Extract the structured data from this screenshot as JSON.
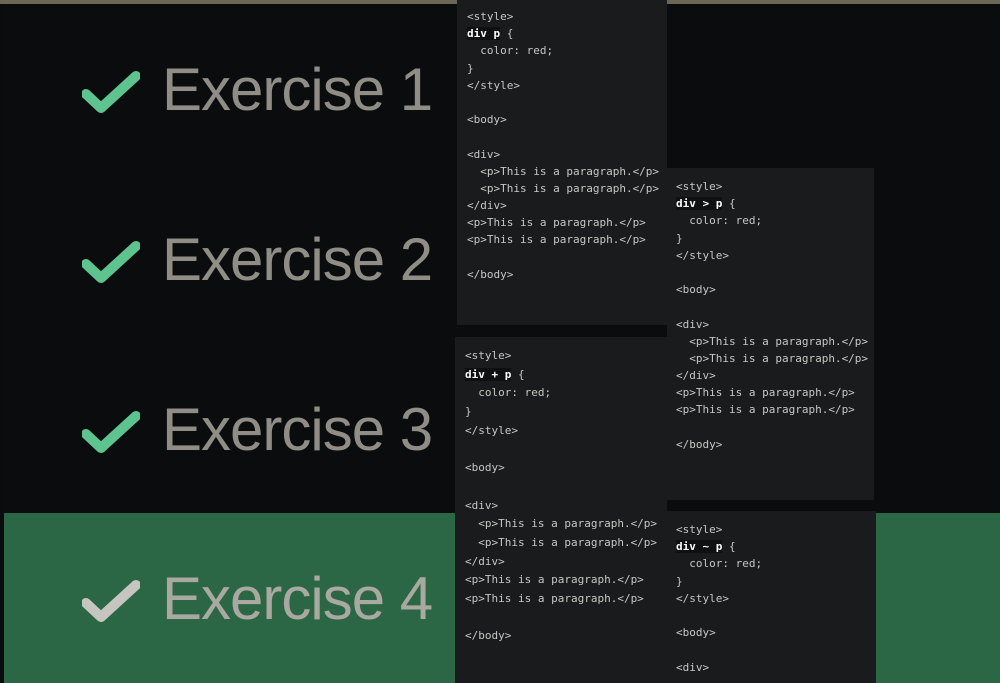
{
  "exercises": [
    {
      "label": "Exercise 1",
      "status": "completed",
      "active": false
    },
    {
      "label": "Exercise 2",
      "status": "completed",
      "active": false
    },
    {
      "label": "Exercise 3",
      "status": "completed",
      "active": false
    },
    {
      "label": "Exercise 4",
      "status": "current",
      "active": true
    }
  ],
  "colors": {
    "background": "#0b0c0e",
    "active_row": "#2b6645",
    "check_done": "#5ec48f",
    "check_current": "#c6c5c0",
    "label": "#8f8d86",
    "code_panel": "#1a1b1d",
    "code_text": "#c7c7c4"
  },
  "code_panels": {
    "descendant": {
      "lines": [
        "<style>",
        "div p {",
        "  color: red;",
        "}",
        "</style>",
        "",
        "<body>",
        "",
        "<div>",
        "  <p>This is a paragraph.</p>",
        "  <p>This is a paragraph.</p>",
        "</div>",
        "<p>This is a paragraph.</p>",
        "<p>This is a paragraph.</p>",
        "",
        "</body>"
      ],
      "selector": "div p"
    },
    "child": {
      "lines": [
        "<style>",
        "div > p {",
        "  color: red;",
        "}",
        "</style>",
        "",
        "<body>",
        "",
        "<div>",
        "  <p>This is a paragraph.</p>",
        "  <p>This is a paragraph.</p>",
        "</div>",
        "<p>This is a paragraph.</p>",
        "<p>This is a paragraph.</p>",
        "",
        "</body>"
      ],
      "selector": "div > p"
    },
    "adjacent": {
      "lines": [
        "<style>",
        "div + p {",
        "  color: red;",
        "}",
        "</style>",
        "",
        "<body>",
        "",
        "<div>",
        "  <p>This is a paragraph.</p>",
        "  <p>This is a paragraph.</p>",
        "</div>",
        "<p>This is a paragraph.</p>",
        "<p>This is a paragraph.</p>",
        "",
        "</body>"
      ],
      "selector": "div + p"
    },
    "sibling": {
      "lines": [
        "<style>",
        "div ~ p {",
        "  color: red;",
        "}",
        "</style>",
        "",
        "<body>",
        "",
        "<div>"
      ],
      "selector": "div ~ p"
    }
  }
}
